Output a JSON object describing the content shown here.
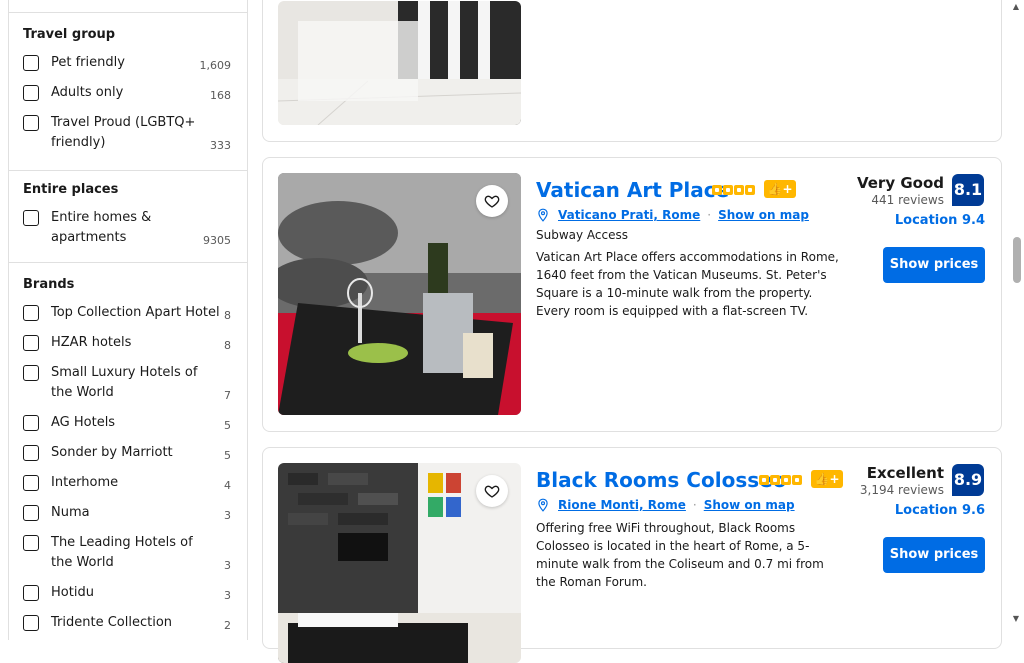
{
  "sidebar": {
    "travel_group": {
      "heading": "Travel group",
      "items": [
        {
          "label": "Pet friendly",
          "count": "1,609"
        },
        {
          "label": "Adults only",
          "count": "168"
        },
        {
          "label": "Travel Proud (LGBTQ+ friendly)",
          "count": "333"
        }
      ]
    },
    "entire_places": {
      "heading": "Entire places",
      "items": [
        {
          "label": "Entire homes & apartments",
          "count": "9305"
        }
      ]
    },
    "brands": {
      "heading": "Brands",
      "items": [
        {
          "label": "Top Collection Apart Hotel",
          "count": "8"
        },
        {
          "label": "HZAR hotels",
          "count": "8"
        },
        {
          "label": "Small Luxury Hotels of the World",
          "count": "7"
        },
        {
          "label": "AG Hotels",
          "count": "5"
        },
        {
          "label": "Sonder by Marriott",
          "count": "5"
        },
        {
          "label": "Interhome",
          "count": "4"
        },
        {
          "label": "Numa",
          "count": "3"
        },
        {
          "label": "The Leading Hotels of the World",
          "count": "3"
        },
        {
          "label": "Hotidu",
          "count": "3"
        },
        {
          "label": "Tridente Collection",
          "count": "2"
        }
      ]
    }
  },
  "cards": [
    {
      "title": "Vatican Art Place",
      "stars": 4,
      "location": "Vaticano Prati, Rome",
      "map_label": "Show on map",
      "subway": "Subway Access",
      "description": "Vatican Art Place offers accommodations in Rome, 1640 feet from the Vatican Museums. St. Peter's Square is a 10-minute walk from the property. Every room is equipped with a flat-screen TV.",
      "review_word": "Very Good",
      "review_count": "441 reviews",
      "score": "8.1",
      "location_score": "Location 9.4",
      "button": "Show prices"
    },
    {
      "title": "Black Rooms Colosseo",
      "stars": 4,
      "location": "Rione Monti, Rome",
      "map_label": "Show on map",
      "description": "Offering free WiFi throughout, Black Rooms Colosseo is located in the heart of Rome, a 5-minute walk from the Coliseum and 0.7 mi from the Roman Forum.",
      "review_word": "Excellent",
      "review_count": "3,194 reviews",
      "score": "8.9",
      "location_score": "Location 9.6",
      "button": "Show prices"
    }
  ],
  "icons": {
    "boost": "thumbs-up-plus-icon",
    "heart": "heart-icon",
    "pin": "map-pin-icon"
  },
  "colors": {
    "link": "#006ce4",
    "score_bg": "#003b95",
    "star": "#ffb700",
    "button": "#006ce4"
  }
}
